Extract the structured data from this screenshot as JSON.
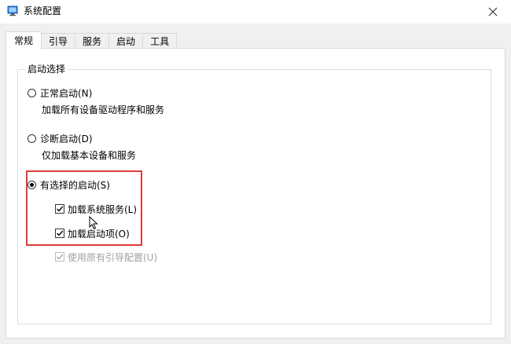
{
  "window": {
    "title": "系统配置",
    "close_icon": "close-icon"
  },
  "tabs": [
    {
      "label": "常规",
      "active": true
    },
    {
      "label": "引导",
      "active": false
    },
    {
      "label": "服务",
      "active": false
    },
    {
      "label": "启动",
      "active": false
    },
    {
      "label": "工具",
      "active": false
    }
  ],
  "general": {
    "group_title": "启动选择",
    "normal": {
      "label": "正常启动(N)",
      "description": "加载所有设备驱动程序和服务",
      "selected": false
    },
    "diagnostic": {
      "label": "诊断启动(D)",
      "description": "仅加载基本设备和服务",
      "selected": false
    },
    "selective": {
      "label": "有选择的启动(S)",
      "selected": true,
      "options": [
        {
          "label": "加载系统服务(L)",
          "checked": true,
          "enabled": true
        },
        {
          "label": "加载启动项(O)",
          "checked": true,
          "enabled": true
        },
        {
          "label": "使用原有引导配置(U)",
          "checked": true,
          "enabled": false
        }
      ]
    }
  },
  "colors": {
    "highlight_border": "#e03a3a",
    "disabled_text": "#a0a0a0"
  }
}
